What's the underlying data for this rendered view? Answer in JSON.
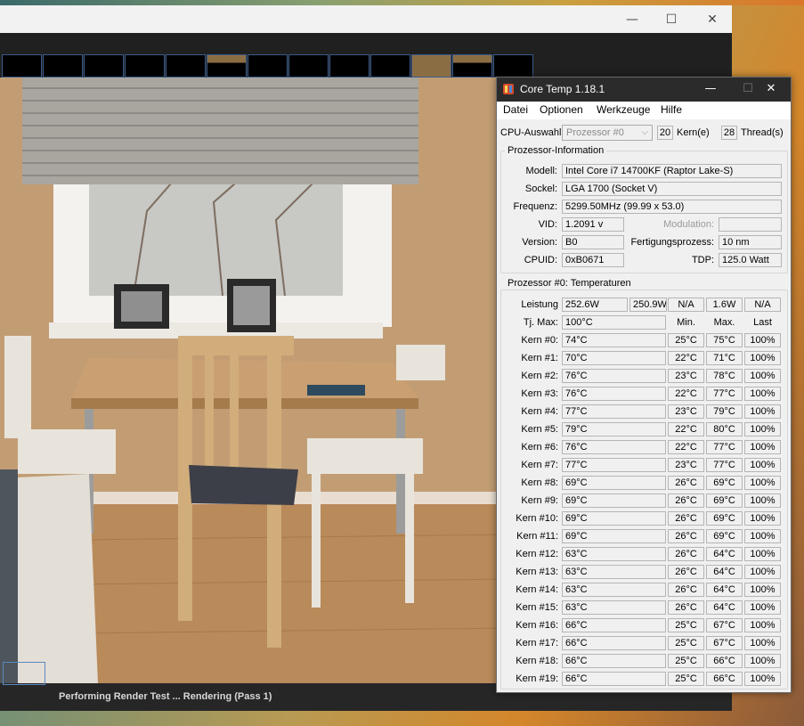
{
  "render_window": {
    "window_controls": {
      "minimize": "—",
      "maximize": "☐",
      "close": "✕"
    },
    "status_text": "Performing Render Test ... Rendering (Pass 1)"
  },
  "coretemp": {
    "title": "Core Temp 1.18.1",
    "window_controls": {
      "minimize": "—",
      "maximize": "☐",
      "close": "✕"
    },
    "menu": [
      "Datei",
      "Optionen",
      "Werkzeuge",
      "Hilfe"
    ],
    "cpu_select": {
      "label": "CPU-Auswahl:",
      "value": "Prozessor #0",
      "cores_count": "20",
      "cores_label": "Kern(e)",
      "threads_count": "28",
      "threads_label": "Thread(s)"
    },
    "info": {
      "title": "Prozessor-Information",
      "model_label": "Modell:",
      "model": "Intel Core i7 14700KF (Raptor Lake-S)",
      "socket_label": "Sockel:",
      "socket": "LGA 1700 (Socket V)",
      "frequency_label": "Frequenz:",
      "frequency": "5299.50MHz (99.99 x 53.0)",
      "vid_label": "VID:",
      "vid": "1.2091 v",
      "modulation_label": "Modulation:",
      "modulation": "",
      "version_label": "Version:",
      "version": "B0",
      "process_label": "Fertigungsprozess:",
      "process": "10 nm",
      "cpuid_label": "CPUID:",
      "cpuid": "0xB0671",
      "tdp_label": "TDP:",
      "tdp": "125.0 Watt"
    },
    "temps": {
      "title": "Prozessor #0: Temperaturen",
      "power_label": "Leistung",
      "power": [
        "252.6W",
        "250.9W",
        "N/A",
        "1.6W",
        "N/A"
      ],
      "tjmax_label": "Tj. Max:",
      "tjmax": "100°C",
      "headers": {
        "min": "Min.",
        "max": "Max.",
        "last": "Last"
      },
      "cores": [
        {
          "name": "Kern #0:",
          "temp": "74°C",
          "min": "25°C",
          "max": "75°C",
          "load": "100%"
        },
        {
          "name": "Kern #1:",
          "temp": "70°C",
          "min": "22°C",
          "max": "71°C",
          "load": "100%"
        },
        {
          "name": "Kern #2:",
          "temp": "76°C",
          "min": "23°C",
          "max": "78°C",
          "load": "100%"
        },
        {
          "name": "Kern #3:",
          "temp": "76°C",
          "min": "22°C",
          "max": "77°C",
          "load": "100%"
        },
        {
          "name": "Kern #4:",
          "temp": "77°C",
          "min": "23°C",
          "max": "79°C",
          "load": "100%"
        },
        {
          "name": "Kern #5:",
          "temp": "79°C",
          "min": "22°C",
          "max": "80°C",
          "load": "100%"
        },
        {
          "name": "Kern #6:",
          "temp": "76°C",
          "min": "22°C",
          "max": "77°C",
          "load": "100%"
        },
        {
          "name": "Kern #7:",
          "temp": "77°C",
          "min": "23°C",
          "max": "77°C",
          "load": "100%"
        },
        {
          "name": "Kern #8:",
          "temp": "69°C",
          "min": "26°C",
          "max": "69°C",
          "load": "100%"
        },
        {
          "name": "Kern #9:",
          "temp": "69°C",
          "min": "26°C",
          "max": "69°C",
          "load": "100%"
        },
        {
          "name": "Kern #10:",
          "temp": "69°C",
          "min": "26°C",
          "max": "69°C",
          "load": "100%"
        },
        {
          "name": "Kern #11:",
          "temp": "69°C",
          "min": "26°C",
          "max": "69°C",
          "load": "100%"
        },
        {
          "name": "Kern #12:",
          "temp": "63°C",
          "min": "26°C",
          "max": "64°C",
          "load": "100%"
        },
        {
          "name": "Kern #13:",
          "temp": "63°C",
          "min": "26°C",
          "max": "64°C",
          "load": "100%"
        },
        {
          "name": "Kern #14:",
          "temp": "63°C",
          "min": "26°C",
          "max": "64°C",
          "load": "100%"
        },
        {
          "name": "Kern #15:",
          "temp": "63°C",
          "min": "26°C",
          "max": "64°C",
          "load": "100%"
        },
        {
          "name": "Kern #16:",
          "temp": "66°C",
          "min": "25°C",
          "max": "67°C",
          "load": "100%"
        },
        {
          "name": "Kern #17:",
          "temp": "66°C",
          "min": "25°C",
          "max": "67°C",
          "load": "100%"
        },
        {
          "name": "Kern #18:",
          "temp": "66°C",
          "min": "25°C",
          "max": "66°C",
          "load": "100%"
        },
        {
          "name": "Kern #19:",
          "temp": "66°C",
          "min": "25°C",
          "max": "66°C",
          "load": "100%"
        }
      ]
    }
  }
}
